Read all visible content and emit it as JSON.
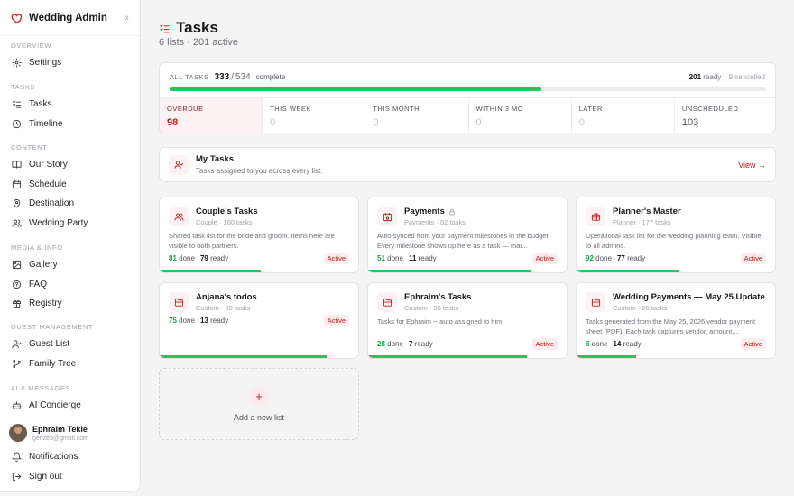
{
  "app": {
    "name": "Wedding Admin",
    "collapse_icon": "«"
  },
  "sidebar": {
    "sections": [
      {
        "label": "Overview",
        "items": [
          {
            "label": "Settings",
            "icon": "gear-icon"
          }
        ]
      },
      {
        "label": "Tasks",
        "items": [
          {
            "label": "Tasks",
            "icon": "checklist-icon"
          },
          {
            "label": "Timeline",
            "icon": "clock-icon"
          }
        ]
      },
      {
        "label": "Content",
        "items": [
          {
            "label": "Our Story",
            "icon": "book-icon"
          },
          {
            "label": "Schedule",
            "icon": "calendar-icon"
          },
          {
            "label": "Destination",
            "icon": "pin-icon"
          },
          {
            "label": "Wedding Party",
            "icon": "users-icon"
          }
        ]
      },
      {
        "label": "Media & Info",
        "items": [
          {
            "label": "Gallery",
            "icon": "image-icon"
          },
          {
            "label": "FAQ",
            "icon": "help-icon"
          },
          {
            "label": "Registry",
            "icon": "gift-icon"
          }
        ]
      },
      {
        "label": "Guest Management",
        "items": [
          {
            "label": "Guest List",
            "icon": "user-check-icon"
          },
          {
            "label": "Family Tree",
            "icon": "branch-icon"
          }
        ]
      },
      {
        "label": "AI & Messages",
        "items": [
          {
            "label": "AI Concierge",
            "icon": "bot-icon"
          }
        ]
      }
    ]
  },
  "user": {
    "name": "Ephraim Tekle",
    "email": "genzeb@gmail.com",
    "notifications_label": "Notifications",
    "signout_label": "Sign out"
  },
  "page": {
    "title": "Tasks",
    "subtitle": "6 lists · 201 active"
  },
  "summary": {
    "label": "All tasks",
    "done": "333",
    "sep": "/",
    "total": "534",
    "complete_label": "complete",
    "ready_count": "201",
    "ready_label": "ready",
    "cancelled_text": "9 cancelled",
    "progress": 0.6236,
    "buckets": [
      {
        "label": "Overdue",
        "value": "98",
        "highlight": true
      },
      {
        "label": "This week",
        "value": "0"
      },
      {
        "label": "This month",
        "value": "0"
      },
      {
        "label": "Within 3 mo",
        "value": "0"
      },
      {
        "label": "Later",
        "value": "0"
      },
      {
        "label": "Unscheduled",
        "value": "103",
        "dark": true
      }
    ]
  },
  "my_tasks": {
    "title": "My Tasks",
    "subtitle": "Tasks assigned to you across every list.",
    "view_label": "View →"
  },
  "lists": [
    {
      "title": "Couple's Tasks",
      "meta": "Couple · 160 tasks",
      "icon": "users-icon",
      "desc": "Shared task list for the bride and groom. Items here are visible to both partners.",
      "done": "81",
      "ready": "79",
      "status": "Active",
      "progress": 0.51,
      "locked": false
    },
    {
      "title": "Payments",
      "meta": "Payments · 62 tasks",
      "icon": "payment-calendar-icon",
      "desc": "Auto-synced from your payment milestones in the budget. Every milestone shows up here as a task — mar...",
      "done": "51",
      "ready": "11",
      "status": "Active",
      "progress": 0.82,
      "locked": true
    },
    {
      "title": "Planner's Master",
      "meta": "Planner · 177 tasks",
      "icon": "briefcase-icon",
      "desc": "Operational task list for the wedding planning team. Visible to all admins.",
      "done": "92",
      "ready": "77",
      "status": "Active",
      "progress": 0.52,
      "locked": false
    },
    {
      "title": "Anjana's todos",
      "meta": "Custom · 89 tasks",
      "icon": "folder-icon",
      "desc": "",
      "done": "75",
      "ready": "13",
      "status": "Active",
      "progress": 0.84,
      "locked": false
    },
    {
      "title": "Ephraim's Tasks",
      "meta": "Custom · 35 tasks",
      "icon": "folder-icon",
      "desc": "Tasks for Ephraim -- auto assigned to him.",
      "done": "28",
      "ready": "7",
      "status": "Active",
      "progress": 0.8,
      "locked": false
    },
    {
      "title": "Wedding Payments — May 25 Update",
      "meta": "Custom · 20 tasks",
      "icon": "folder-icon",
      "desc": "Tasks generated from the May 25, 2026 vendor payment sheet (PDF). Each task captures vendor, amount,...",
      "done": "6",
      "ready": "14",
      "status": "Active",
      "progress": 0.3,
      "locked": false
    }
  ],
  "labels": {
    "done": "done",
    "ready": "ready"
  },
  "add_list": {
    "plus": "+",
    "label": "Add a new list"
  },
  "colors": {
    "accent": "#b91c1c",
    "success": "#22c55e",
    "brand": "#dc2626"
  }
}
